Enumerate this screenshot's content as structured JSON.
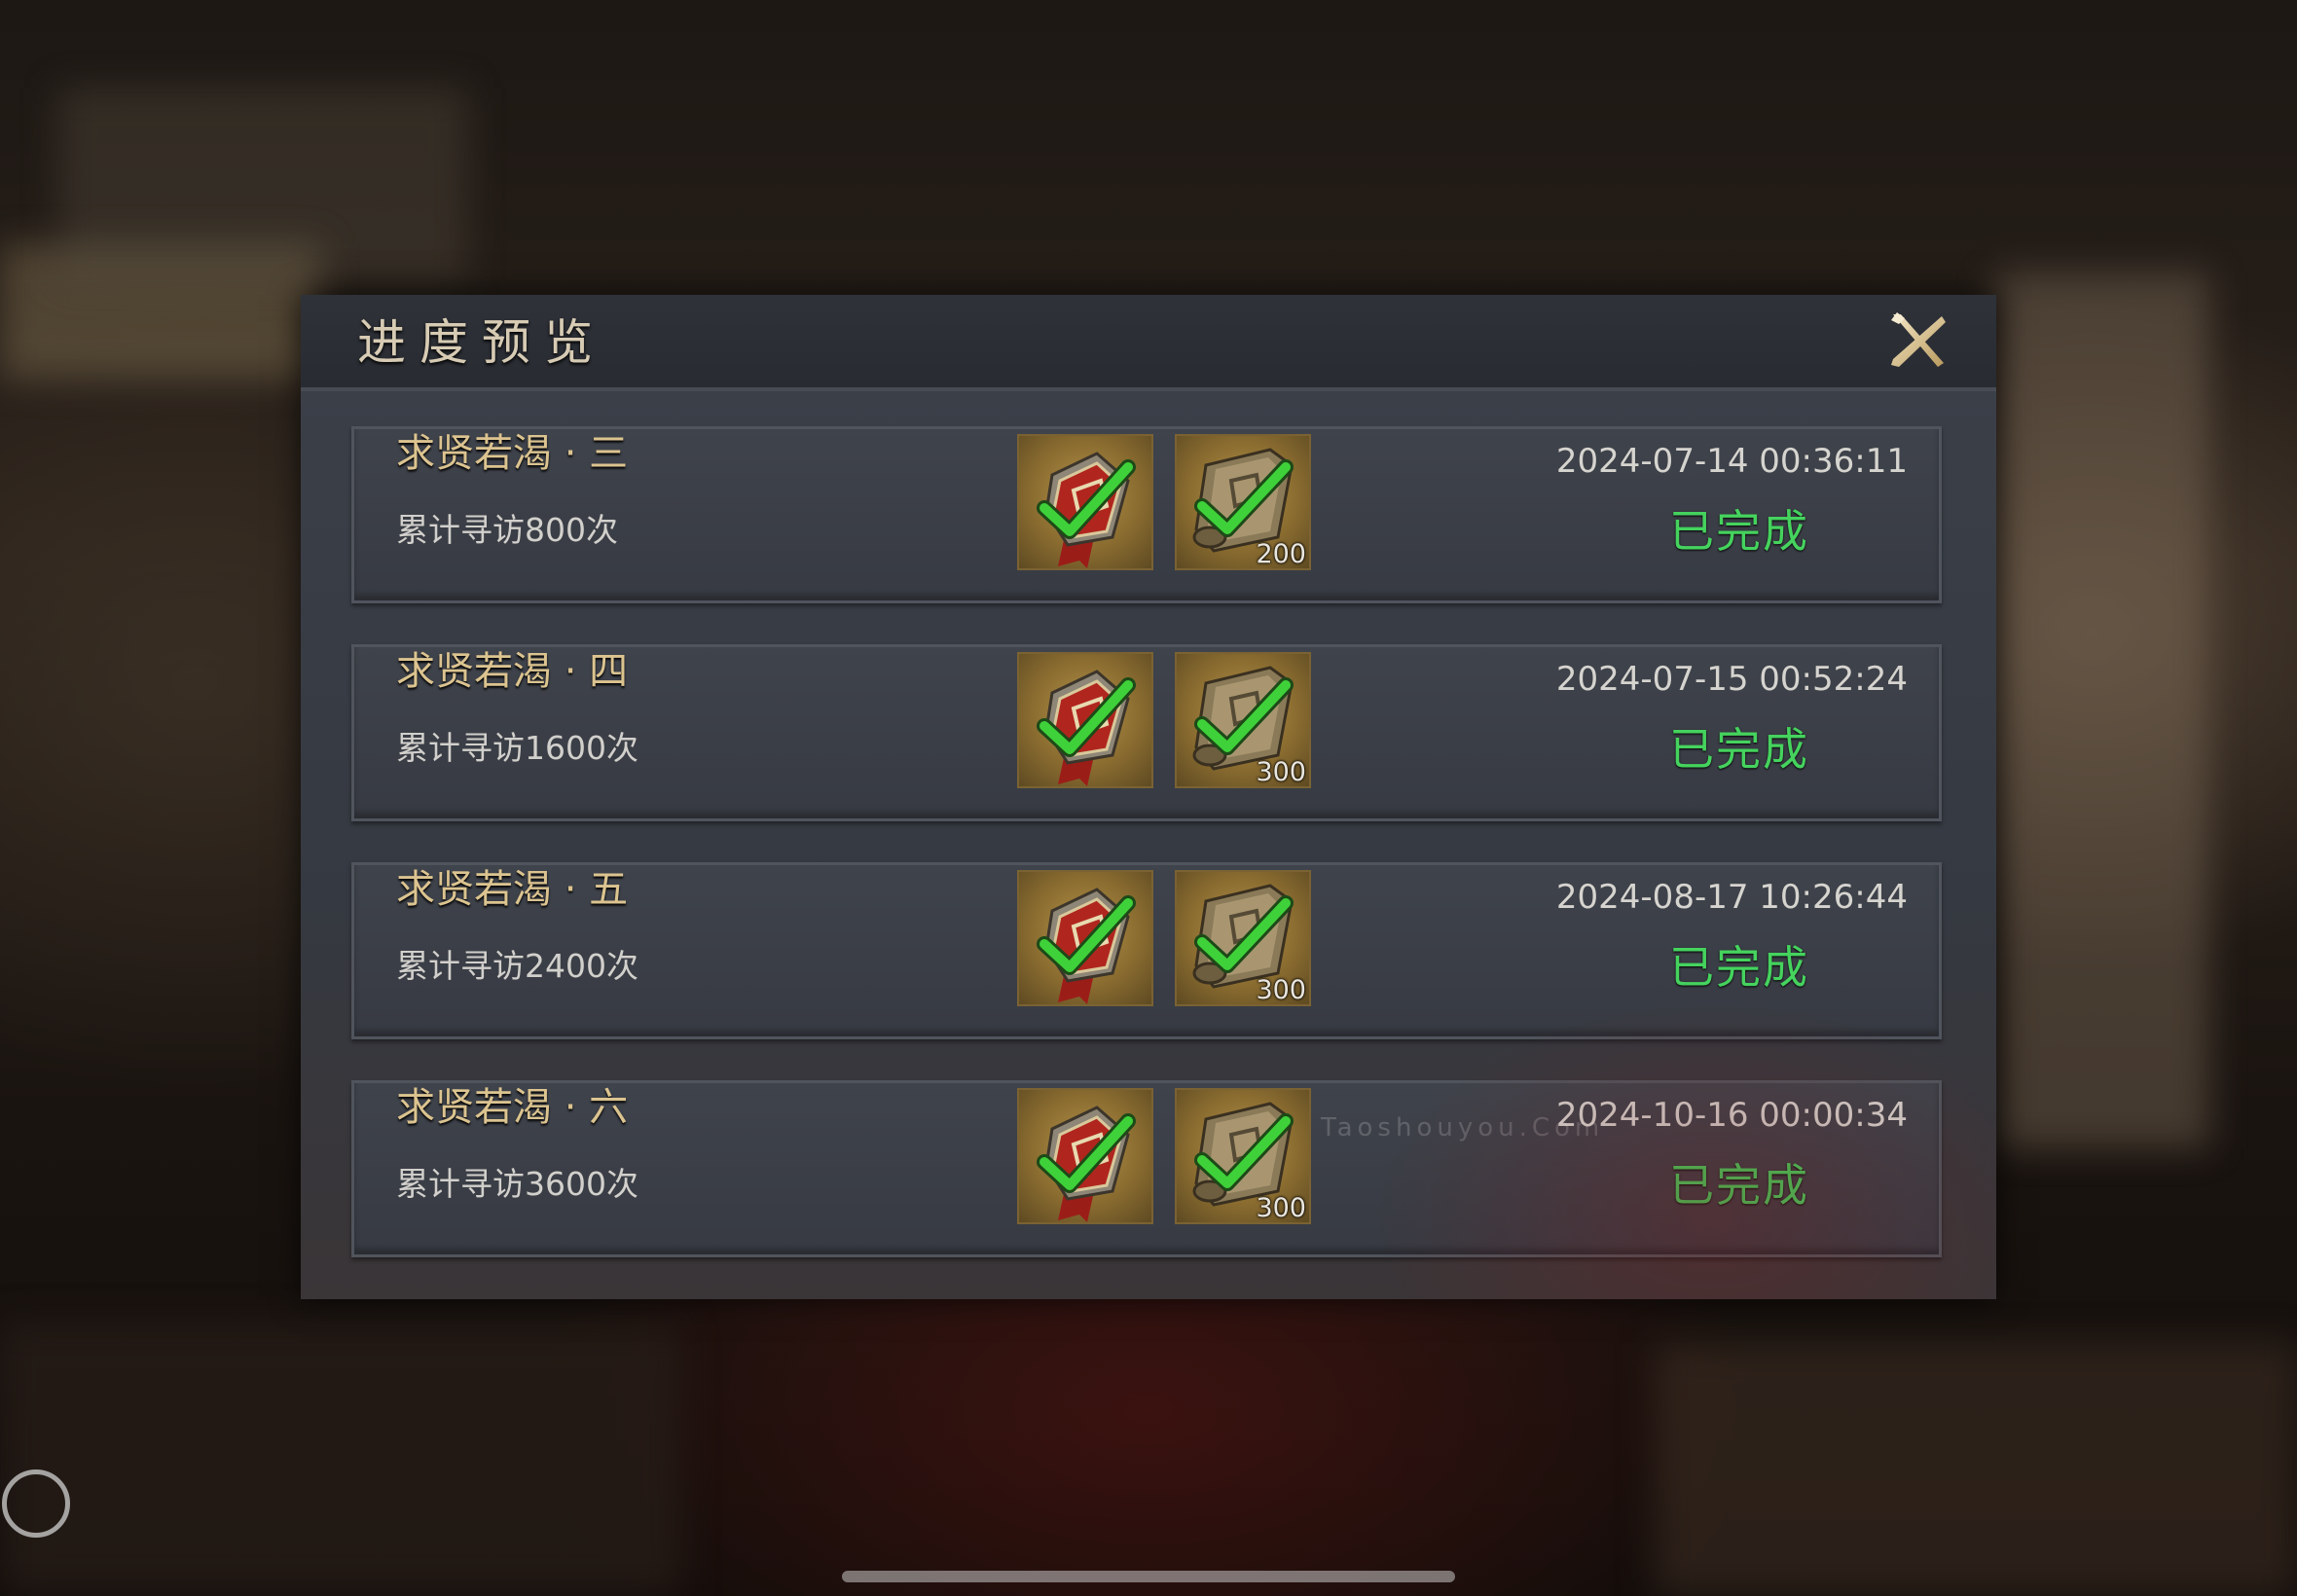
{
  "dialog": {
    "title": "进度预览",
    "close_icon": "close-x-icon"
  },
  "rows": [
    {
      "title": "求贤若渴 · 三",
      "desc": "累计寻访800次",
      "rewards": [
        {
          "icon": "token-badge-icon",
          "count": ""
        },
        {
          "icon": "scroll-icon",
          "count": "200"
        }
      ],
      "time": "2024-07-14 00:36:11",
      "status": "已完成"
    },
    {
      "title": "求贤若渴 · 四",
      "desc": "累计寻访1600次",
      "rewards": [
        {
          "icon": "token-badge-icon",
          "count": ""
        },
        {
          "icon": "scroll-icon",
          "count": "300"
        }
      ],
      "time": "2024-07-15 00:52:24",
      "status": "已完成"
    },
    {
      "title": "求贤若渴 · 五",
      "desc": "累计寻访2400次",
      "rewards": [
        {
          "icon": "token-badge-icon",
          "count": ""
        },
        {
          "icon": "scroll-icon",
          "count": "300"
        }
      ],
      "time": "2024-08-17 10:26:44",
      "status": "已完成"
    },
    {
      "title": "求贤若渴 · 六",
      "desc": "累计寻访3600次",
      "rewards": [
        {
          "icon": "token-badge-icon",
          "count": ""
        },
        {
          "icon": "scroll-icon",
          "count": "300"
        }
      ],
      "time": "2024-10-16 00:00:34",
      "status": "已完成"
    }
  ],
  "watermark": "Taoshouyou.Com",
  "colors": {
    "status_green": "#45d35e",
    "title_gold": "#dcc490",
    "check_green": "#3fd13a"
  }
}
